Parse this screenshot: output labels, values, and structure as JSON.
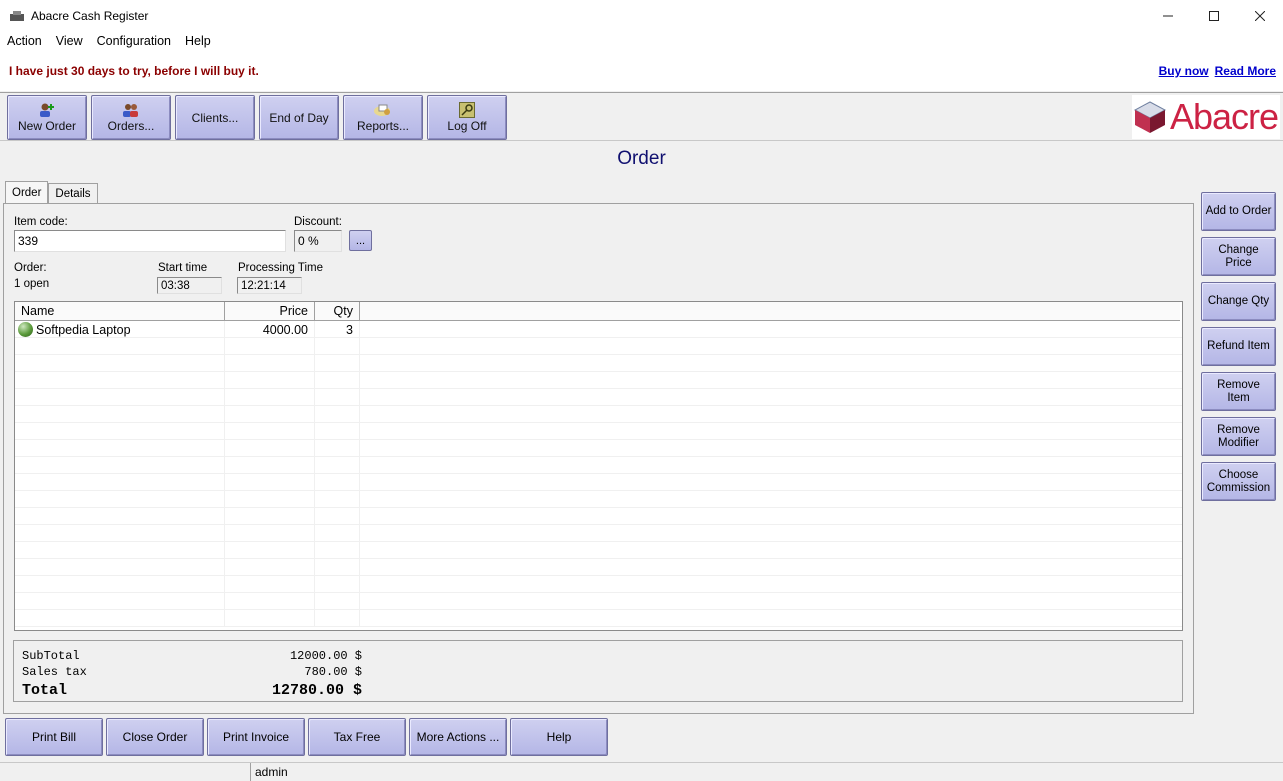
{
  "window": {
    "title": "Abacre Cash Register"
  },
  "menu": [
    "Action",
    "View",
    "Configuration",
    "Help"
  ],
  "trial": {
    "message": "I have just 30 days to try, before I will buy it.",
    "buy_now": "Buy now",
    "read_more": "Read More"
  },
  "toolbar": [
    {
      "label": "New Order",
      "icon": "new-order-icon"
    },
    {
      "label": "Orders...",
      "icon": "orders-icon"
    },
    {
      "label": "Clients...",
      "icon": ""
    },
    {
      "label": "End of Day",
      "icon": ""
    },
    {
      "label": "Reports...",
      "icon": "reports-icon"
    },
    {
      "label": "Log Off",
      "icon": "key-icon"
    }
  ],
  "logo": {
    "text": "Abacre"
  },
  "page": {
    "title": "Order"
  },
  "tabs": [
    "Order",
    "Details"
  ],
  "form": {
    "item_code_label": "Item code:",
    "item_code_value": "339",
    "discount_label": "Discount:",
    "discount_value": "0 %",
    "discount_button": "...",
    "order_label": "Order:",
    "order_value": "1 open",
    "start_time_label": "Start time",
    "start_time_value": "03:38",
    "processing_time_label": "Processing Time",
    "processing_time_value": "12:21:14"
  },
  "grid": {
    "columns": [
      "Name",
      "Price",
      "Qty"
    ],
    "rows": [
      {
        "name": "Softpedia Laptop",
        "price": "4000.00",
        "qty": "3"
      }
    ]
  },
  "totals": {
    "subtotal_label": "SubTotal",
    "subtotal_value": "12000.00 $",
    "tax_label": "Sales tax",
    "tax_value": "780.00 $",
    "total_label": "Total",
    "total_value": "12780.00 $"
  },
  "side_buttons": [
    "Add to Order",
    "Change Price",
    "Change Qty",
    "Refund Item",
    "Remove Item",
    "Remove Modifier",
    "Choose Commission"
  ],
  "bottom_buttons": [
    "Print Bill",
    "Close Order",
    "Print Invoice",
    "Tax Free",
    "More Actions ...",
    "Help"
  ],
  "status": {
    "user": "admin"
  }
}
